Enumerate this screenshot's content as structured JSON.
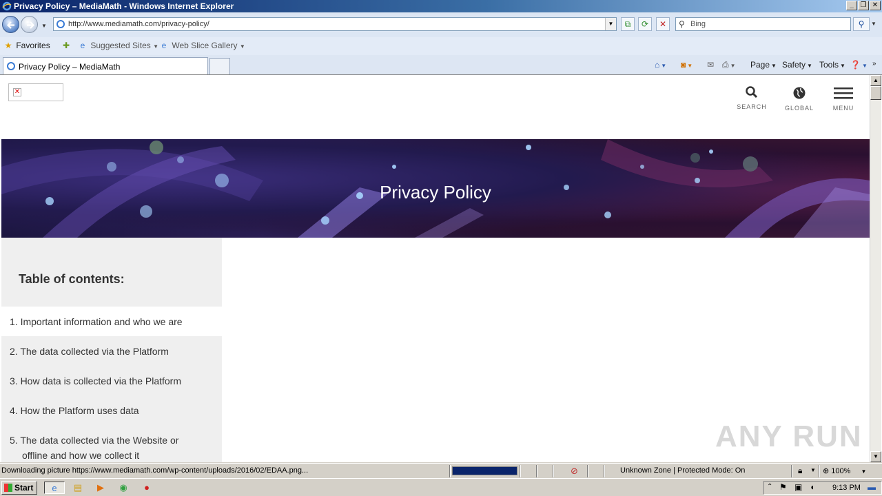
{
  "window": {
    "title": "Privacy Policy – MediaMath - Windows Internet Explorer",
    "controls": [
      "_",
      "❐",
      "✕"
    ]
  },
  "addressbar": {
    "url": "http://www.mediamath.com/privacy-policy/",
    "search_placeholder": "Bing"
  },
  "favorites_bar": {
    "favorites_label": "Favorites",
    "items": [
      "Suggested Sites",
      "Web Slice Gallery"
    ]
  },
  "tabs": [
    {
      "label": "Privacy Policy – MediaMath"
    }
  ],
  "command_bar": {
    "page_label": "Page",
    "safety_label": "Safety",
    "tools_label": "Tools"
  },
  "site": {
    "header": {
      "search_label": "SEARCH",
      "global_label": "GLOBAL",
      "menu_label": "MENU"
    },
    "hero_title": "Privacy Policy",
    "toc": {
      "title": "Table of contents:",
      "items": [
        "1. Important information and who we are",
        "2. The data collected via the Platform",
        "3. How data is collected via the Platform",
        "4. How the Platform uses data",
        "5. The data collected via the Website or"
      ],
      "item5_continuation": "offline and how we collect it"
    }
  },
  "watermark": "ANY RUN",
  "statusbar": {
    "text": "Downloading picture https://www.mediamath.com/wp-content/uploads/2016/02/EDAA.png...",
    "progress_fraction": 1.0,
    "zone": "Unknown Zone | Protected Mode: On",
    "zoom": "100%"
  },
  "taskbar": {
    "start_label": "Start",
    "clock": "9:13 PM"
  },
  "colors": {
    "titlebar": "#0a246a",
    "toc_bg": "#efefef",
    "hero_dark": "#1c1640"
  }
}
